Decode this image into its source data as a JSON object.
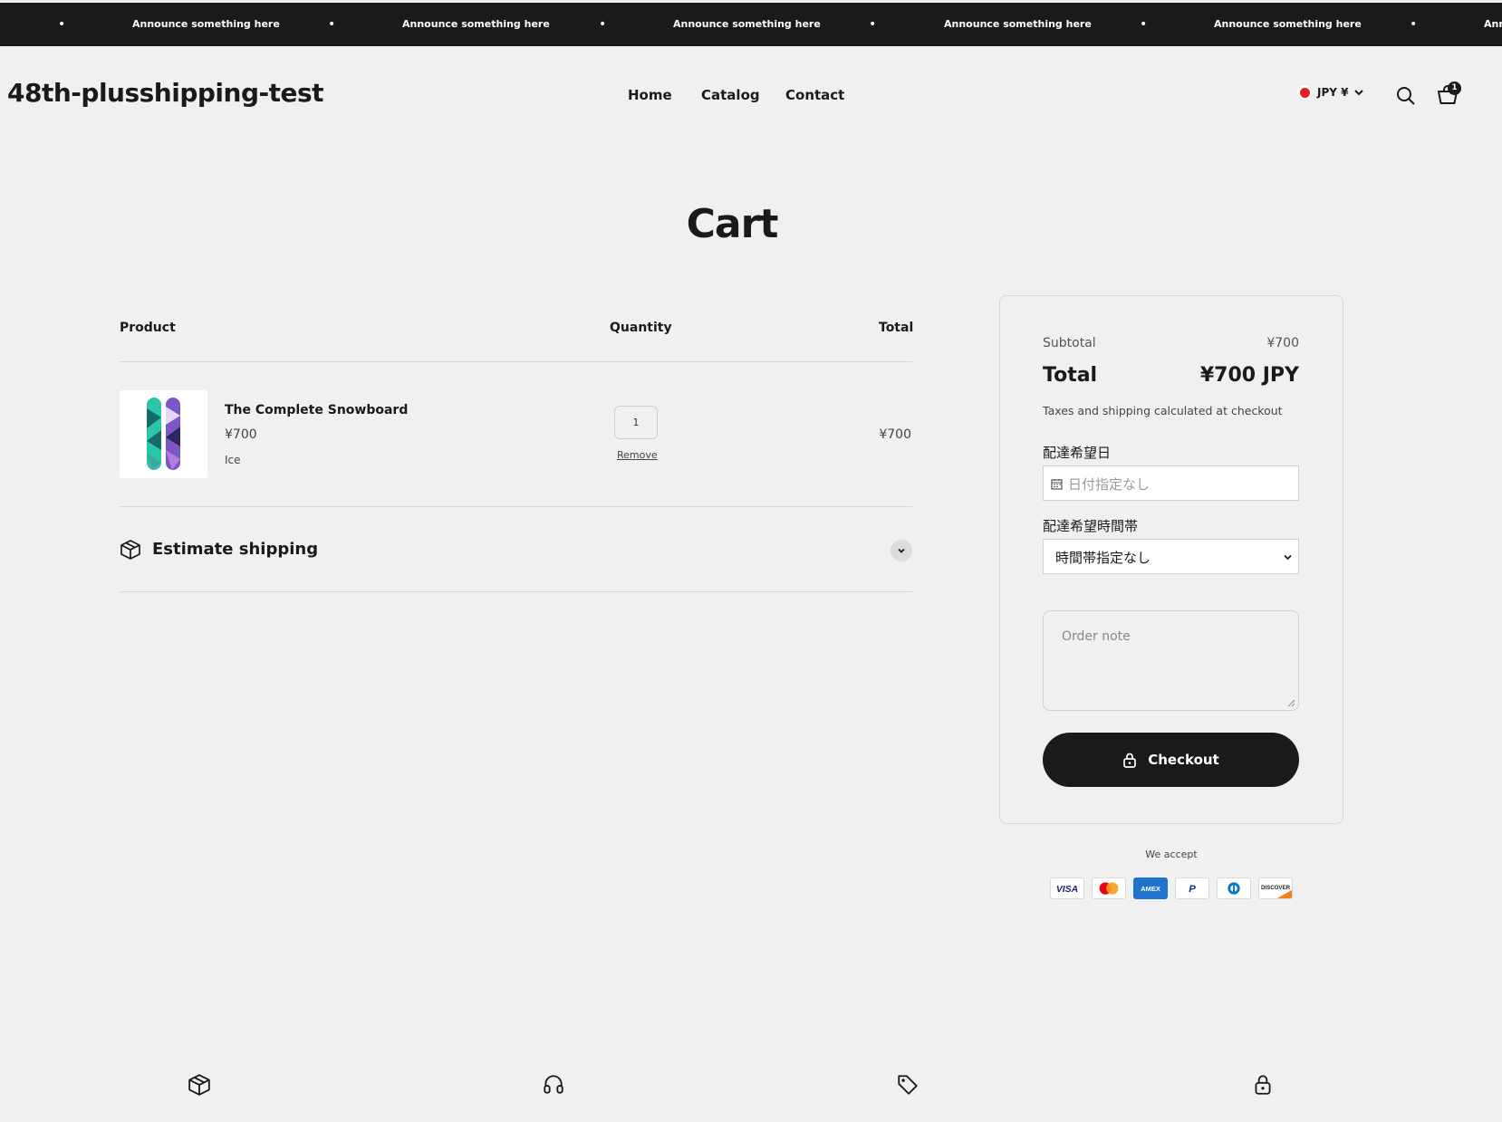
{
  "announcement": {
    "text": "Announce something here",
    "separator": "•"
  },
  "header": {
    "logo": "48th-plusshipping-test",
    "nav": [
      "Home",
      "Catalog",
      "Contact"
    ],
    "currency": "JPY ¥",
    "cart_count": "1"
  },
  "page": {
    "title": "Cart"
  },
  "cart_table": {
    "col_product": "Product",
    "col_quantity": "Quantity",
    "col_total": "Total"
  },
  "line_item": {
    "title": "The Complete Snowboard",
    "price": "¥700",
    "variant": "Ice",
    "quantity": "1",
    "remove_label": "Remove",
    "line_total": "¥700"
  },
  "shipping": {
    "label": "Estimate shipping"
  },
  "summary": {
    "subtotal_label": "Subtotal",
    "subtotal_value": "¥700",
    "total_label": "Total",
    "total_value": "¥700 JPY",
    "tax_note": "Taxes and shipping calculated at checkout",
    "date_label": "配達希望日",
    "date_placeholder": "日付指定なし",
    "time_label": "配達希望時間帯",
    "time_value": "時間帯指定なし",
    "note_placeholder": "Order note",
    "checkout_label": "Checkout"
  },
  "payments": {
    "label": "We accept",
    "methods": [
      "visa",
      "mastercard",
      "amex",
      "paypal",
      "diners",
      "discover"
    ]
  },
  "features": {
    "icons": [
      "box-icon",
      "headset-icon",
      "tag-icon",
      "lock-icon"
    ]
  },
  "colors": {
    "background": "#f0f0f0",
    "dark": "#1a1a1a",
    "flag_red": "#e4201c"
  }
}
